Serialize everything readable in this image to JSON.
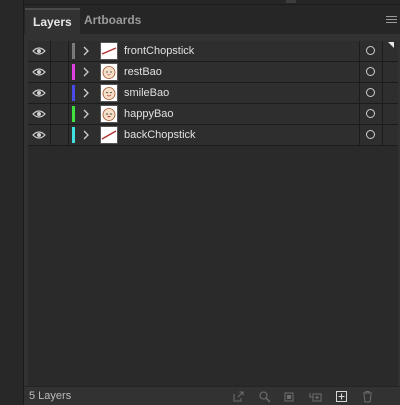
{
  "tabs": [
    {
      "label": "Layers",
      "active": true
    },
    {
      "label": "Artboards",
      "active": false
    }
  ],
  "layers": [
    {
      "name": "frontChopstick",
      "color": "#7a7a7a",
      "thumbnail": "chopstick-thumbnail",
      "selected": true
    },
    {
      "name": "restBao",
      "color": "#e040e0",
      "thumbnail": "bao-face-thumbnail"
    },
    {
      "name": "smileBao",
      "color": "#4a4ae8",
      "thumbnail": "bao-face-thumbnail"
    },
    {
      "name": "happyBao",
      "color": "#40e040",
      "thumbnail": "bao-face-thumbnail"
    },
    {
      "name": "backChopstick",
      "color": "#40e0e0",
      "thumbnail": "chopstick-thumbnail"
    }
  ],
  "footer": {
    "layer_count": "5 Layers",
    "icons": [
      "export-icon",
      "locate-object-icon",
      "make-clipping-mask-icon",
      "create-sublayer-icon",
      "create-new-layer-icon",
      "delete-icon"
    ]
  }
}
